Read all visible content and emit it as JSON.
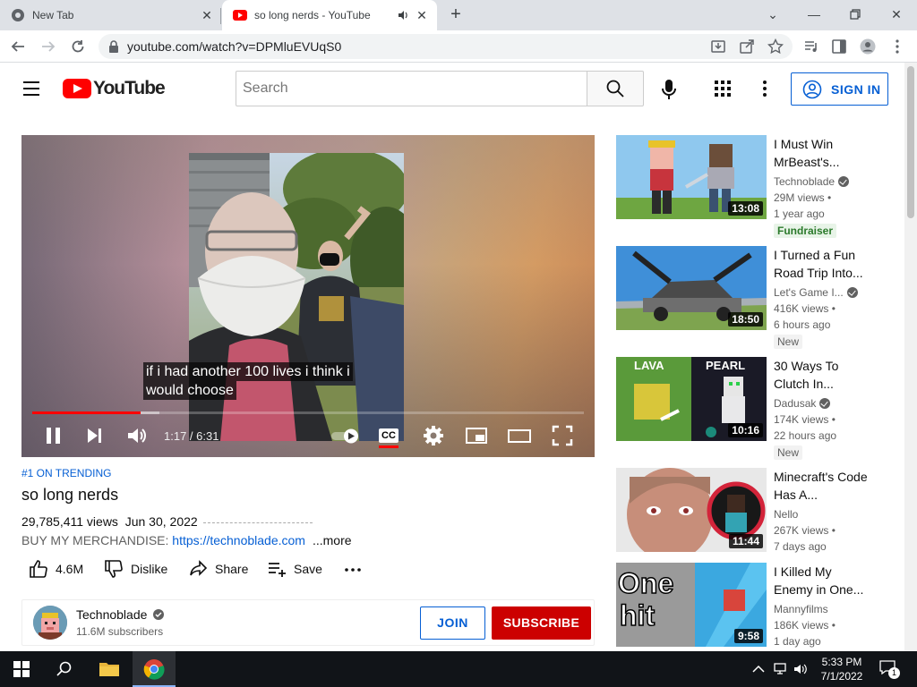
{
  "browser": {
    "tabs": [
      {
        "title": "New Tab",
        "active": false
      },
      {
        "title": "so long nerds - YouTube",
        "active": true
      }
    ],
    "url": "youtube.com/watch?v=DPMluEVUqS0"
  },
  "youtube": {
    "logo_text": "YouTube",
    "search_placeholder": "Search",
    "sign_in_label": "SIGN IN"
  },
  "player": {
    "captions": [
      "if i had another 100 lives i think i",
      "would choose"
    ],
    "time": "1:17 / 6:31",
    "progress_played_fraction": 0.197,
    "progress_loaded_fraction": 0.23,
    "cc_label": "CC"
  },
  "video": {
    "trending": "#1 ON TRENDING",
    "title": "so long nerds",
    "views": "29,785,411 views",
    "date": "Jun 30, 2022",
    "desc_prefix": "BUY MY MERCHANDISE: ",
    "desc_link": "https://technoblade.com",
    "more_label": "...more",
    "likes": "4.6M",
    "dislike_label": "Dislike",
    "share_label": "Share",
    "save_label": "Save"
  },
  "channel": {
    "name": "Technoblade",
    "subscribers": "11.6M subscribers",
    "join_label": "JOIN",
    "subscribe_label": "SUBSCRIBE"
  },
  "recommendations": [
    {
      "title": "I Must Win MrBeast's...",
      "channel": "Technoblade",
      "verified": true,
      "views": "29M views •",
      "age": "1 year ago",
      "badge": "Fundraiser",
      "duration": "13:08"
    },
    {
      "title": "I Turned a Fun Road Trip Into...",
      "channel": "Let's Game I...",
      "verified": true,
      "views": "416K views •",
      "age": "6 hours ago",
      "badge": "New",
      "duration": "18:50"
    },
    {
      "title": "30 Ways To Clutch In...",
      "channel": "Dadusak",
      "verified": true,
      "views": "174K views •",
      "age": "22 hours ago",
      "badge": "New",
      "duration": "10:16",
      "thumb_text": [
        "LAVA",
        "PEARL"
      ]
    },
    {
      "title": "Minecraft's Code Has A...",
      "channel": "Nello",
      "verified": false,
      "views": "267K views •",
      "age": "7 days ago",
      "badge": "",
      "duration": "11:44"
    },
    {
      "title": "I Killed My Enemy in One...",
      "channel": "Mannyfilms",
      "verified": false,
      "views": "186K views •",
      "age": "1 day ago",
      "badge": "",
      "duration": "9:58",
      "thumb_text": [
        "One",
        "hit"
      ]
    }
  ],
  "taskbar": {
    "time": "5:33 PM",
    "date": "7/1/2022",
    "notification_count": "1"
  },
  "colors": {
    "yt_red": "#ff0000",
    "subscribe_red": "#cc0000",
    "link_blue": "#065fd4",
    "taskbar": "#111418"
  }
}
